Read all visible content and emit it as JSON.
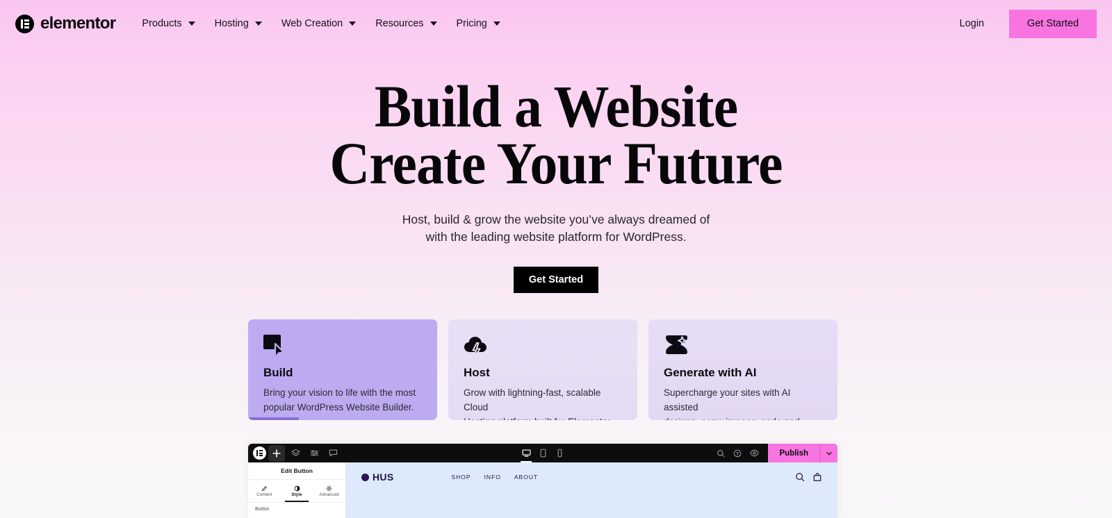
{
  "brand": {
    "name": "elementor",
    "logo_icon": "elementor-logo-icon"
  },
  "nav": {
    "items": [
      {
        "label": "Products",
        "icon": "chevron-down-icon"
      },
      {
        "label": "Hosting",
        "icon": "chevron-down-icon"
      },
      {
        "label": "Web Creation",
        "icon": "chevron-down-icon"
      },
      {
        "label": "Resources",
        "icon": "chevron-down-icon"
      },
      {
        "label": "Pricing",
        "icon": "chevron-down-icon"
      }
    ],
    "login_label": "Login",
    "cta_label": "Get Started",
    "cta_color": "#f875e1"
  },
  "hero": {
    "title_line1": "Build a Website",
    "title_line2": "Create Your Future",
    "subtitle_line1": "Host, build & grow the website you’ve always dreamed of",
    "subtitle_line2": "with the leading website platform for WordPress.",
    "cta_label": "Get Started"
  },
  "cards": [
    {
      "icon": "cursor-select-icon",
      "title": "Build",
      "desc_line1": "Bring your vision to life with the most",
      "desc_line2": "popular WordPress Website Builder.",
      "active": true,
      "bg": "#bdaaf0",
      "progress_pct": 27
    },
    {
      "icon": "cloud-lightning-icon",
      "title": "Host",
      "desc_line1": "Grow with lightning-fast, scalable Cloud",
      "desc_line2": "Hosting platform built for Elementor.",
      "active": false,
      "bg": "#e7ddf4",
      "progress_pct": 0
    },
    {
      "icon": "ai-sparkle-icon",
      "title": "Generate with AI",
      "desc_line1": "Supercharge your sites with AI assisted",
      "desc_line2": "designs, copy, images, code and more.",
      "active": false,
      "bg": "#e6dbf4",
      "progress_pct": 0
    }
  ],
  "editor": {
    "toolbar": {
      "logo_icon": "elementor-logo-icon",
      "tools": [
        {
          "icon": "plus-icon",
          "name": "add-element-button",
          "selected": true
        },
        {
          "icon": "layers-icon",
          "name": "navigator-button",
          "selected": false
        },
        {
          "icon": "sliders-icon",
          "name": "site-settings-button",
          "selected": false
        },
        {
          "icon": "comment-icon",
          "name": "notes-button",
          "selected": false
        }
      ],
      "devices": [
        {
          "icon": "desktop-icon",
          "name": "device-desktop",
          "selected": true
        },
        {
          "icon": "tablet-icon",
          "name": "device-tablet",
          "selected": false
        },
        {
          "icon": "mobile-icon",
          "name": "device-mobile",
          "selected": false
        }
      ],
      "right_icons": [
        {
          "icon": "search-icon",
          "name": "finder-button"
        },
        {
          "icon": "help-icon",
          "name": "help-button"
        },
        {
          "icon": "eye-icon",
          "name": "preview-button"
        }
      ],
      "publish_label": "Publish",
      "publish_arrow_icon": "chevron-down-icon",
      "publish_color": "#f875e1"
    },
    "panel": {
      "title": "Edit Button",
      "tabs": [
        {
          "label": "Content",
          "icon": "pencil-icon",
          "selected": false
        },
        {
          "label": "Style",
          "icon": "contrast-icon",
          "selected": true
        },
        {
          "label": "Advanced",
          "icon": "gear-icon",
          "selected": false
        }
      ],
      "section_label": "Button"
    },
    "canvas": {
      "site_logo": "HUS",
      "site_logo_icon": "circle-dot-icon",
      "site_links": [
        "SHOP",
        "INFO",
        "ABOUT"
      ],
      "site_icons": [
        {
          "icon": "search-icon",
          "name": "site-search-icon"
        },
        {
          "icon": "bag-icon",
          "name": "site-cart-icon"
        }
      ]
    }
  }
}
